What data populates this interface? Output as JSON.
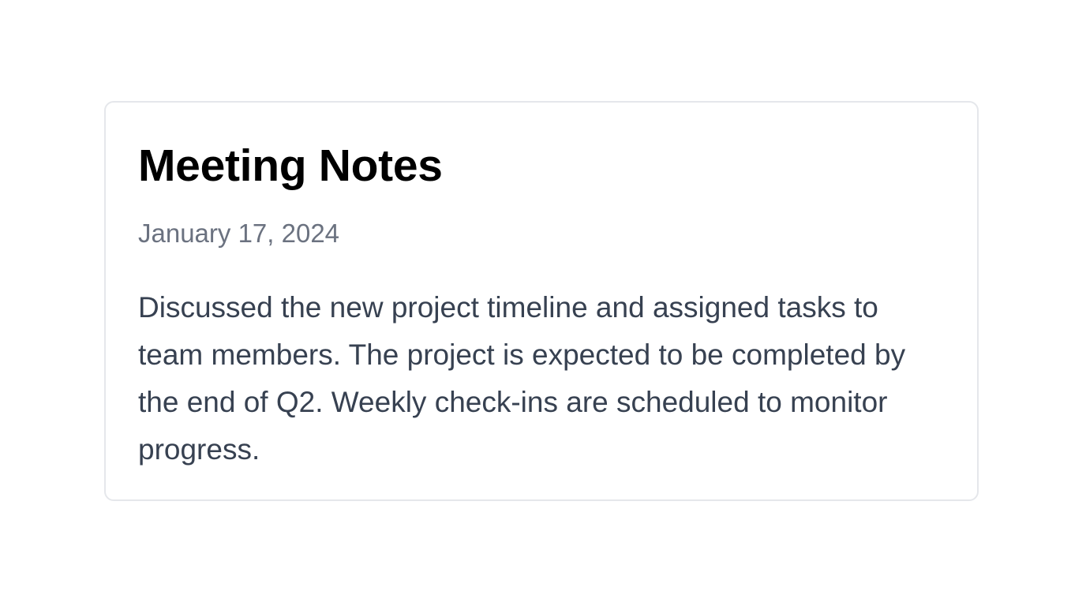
{
  "note": {
    "title": "Meeting Notes",
    "date": "January 17, 2024",
    "body": "Discussed the new project timeline and assigned tasks to team members. The project is expected to be completed by the end of Q2. Weekly check-ins are scheduled to monitor progress."
  }
}
